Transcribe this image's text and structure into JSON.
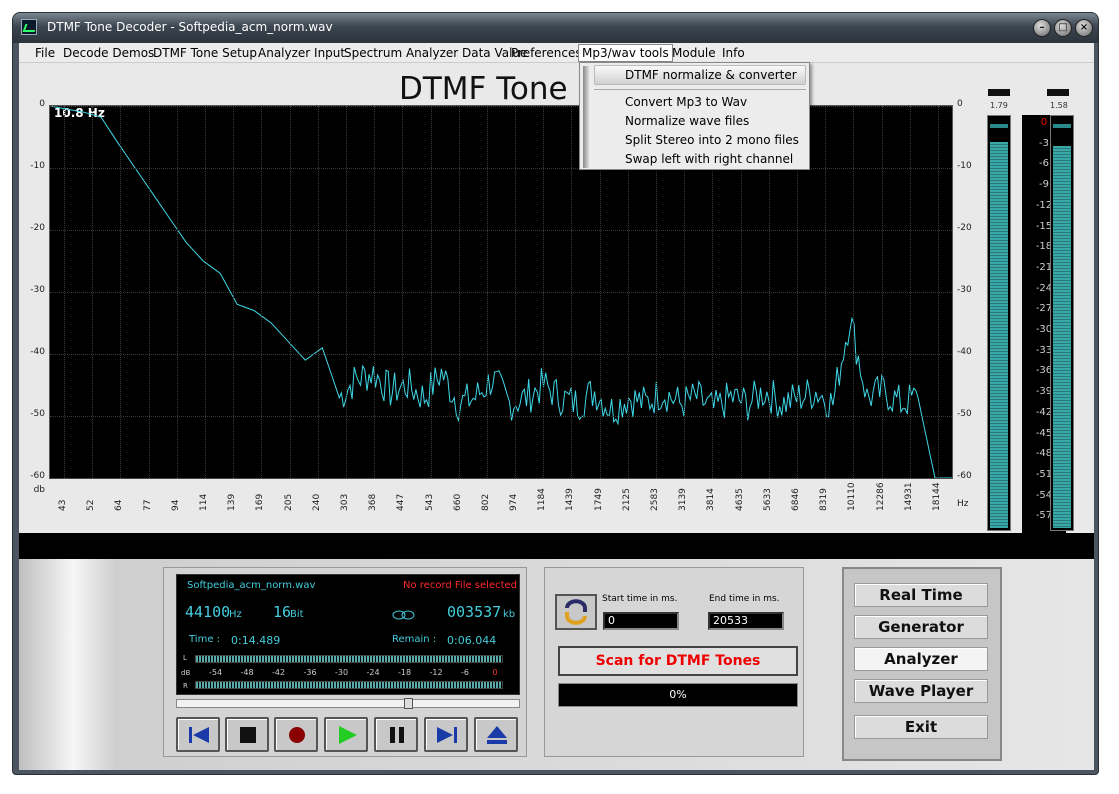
{
  "window": {
    "title": "DTMF Tone Decoder  - Softpedia_acm_norm.wav"
  },
  "menu": [
    "File",
    "Decode Demos",
    "DTMF Tone Setup",
    "Analyzer Input",
    "Spectrum Analyzer Data Value",
    "Preferences",
    "Mp3/wav tools",
    "Module",
    "Info"
  ],
  "dropdown": [
    "DTMF normalize & converter",
    "Convert Mp3 to Wav",
    "Normalize wave files",
    "Split Stereo into 2 mono files",
    "Swap left with right channel"
  ],
  "header": {
    "title": "DTMF Tone"
  },
  "analyzer": {
    "freq_readout": "10.8 Hz",
    "y_ticks": [
      "0",
      "-10",
      "-20",
      "-30",
      "-40",
      "-50",
      "-60"
    ],
    "y_unit": "db",
    "x_unit": "Hz",
    "x_ticks": [
      "43",
      "52",
      "64",
      "77",
      "94",
      "114",
      "139",
      "169",
      "205",
      "240",
      "303",
      "368",
      "447",
      "543",
      "660",
      "802",
      "974",
      "1184",
      "1439",
      "1749",
      "2125",
      "2583",
      "3139",
      "3814",
      "4635",
      "5633",
      "6846",
      "8319",
      "10110",
      "12286",
      "14931",
      "18144"
    ]
  },
  "meters": {
    "left_value": "1.79",
    "right_value": "1.58",
    "left_level": 0.97,
    "right_level": 0.96,
    "scale": [
      "0",
      "-3",
      "-6",
      "-9",
      "-12",
      "-15",
      "-18",
      "-21",
      "-24",
      "-27",
      "-30",
      "-33",
      "-36",
      "-39",
      "-42",
      "-45",
      "-48",
      "-51",
      "-54",
      "-57"
    ]
  },
  "player": {
    "filename": "Softpedia_acm_norm.wav",
    "record_status": "No record File selected",
    "sample_rate": "44100",
    "sample_rate_unit": "Hz",
    "bits": "16",
    "bits_unit": "Bit",
    "size": "003537",
    "size_unit": "kb",
    "time_label": "Time :",
    "time": "0:14.489",
    "remain_label": "Remain :",
    "remain": "0:06.044",
    "vu_scale": [
      "-54",
      "-48",
      "-42",
      "-36",
      "-30",
      "-24",
      "-18",
      "-12",
      "-6",
      "0"
    ],
    "vu_l": "L",
    "vu_db": "dB",
    "vu_r": "R",
    "seek_position": 0.68
  },
  "scan": {
    "start_label": "Start time in ms.",
    "start_value": "0",
    "end_label": "End time in ms.",
    "end_value": "20533",
    "scan_button": "Scan for DTMF Tones",
    "progress": "0%"
  },
  "nav": [
    "Real Time",
    "Generator",
    "Analyzer",
    "Wave Player",
    "Exit"
  ],
  "colors": {
    "trace": "#3fd8e8",
    "scan_text": "#e00000",
    "record_status": "#ff2a2a"
  },
  "chart_data": {
    "type": "line",
    "xlabel": "Hz",
    "ylabel": "db",
    "ylim": [
      -60,
      0
    ],
    "x_categories": [
      "43",
      "52",
      "64",
      "77",
      "94",
      "114",
      "139",
      "169",
      "205",
      "240",
      "303",
      "368",
      "447",
      "543",
      "660",
      "802",
      "974",
      "1184",
      "1439",
      "1749",
      "2125",
      "2583",
      "3139",
      "3814",
      "4635",
      "5633",
      "6846",
      "8319",
      "10110",
      "12286",
      "14931",
      "18144"
    ],
    "series": [
      {
        "values": [
          0,
          -0.5,
          -1.0,
          -1.8,
          -6,
          -10,
          -14,
          -18,
          -22,
          -25,
          -27,
          -32,
          -33,
          -35,
          -38,
          -41,
          -39,
          -47,
          -44,
          -43,
          -46,
          -45,
          -47,
          -43,
          -48,
          -47,
          -44,
          -48,
          -47,
          -45,
          -47,
          -48,
          -46,
          -49,
          -47,
          -48,
          -46,
          -48,
          -47,
          -49,
          -47,
          -48,
          -46,
          -48,
          -47,
          -46,
          -48,
          -34,
          -47,
          -46,
          -48,
          -47,
          -60,
          -60
        ]
      }
    ]
  }
}
